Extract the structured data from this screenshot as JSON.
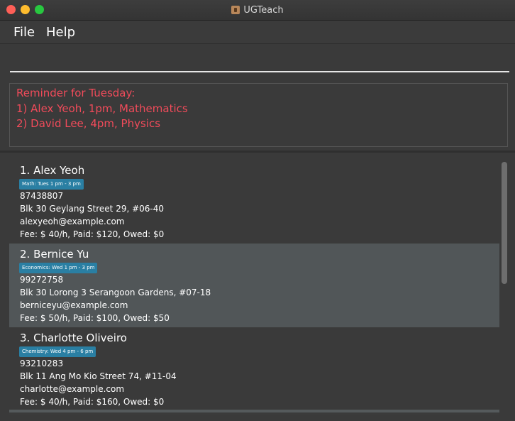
{
  "window": {
    "title": "UGTeach"
  },
  "menu": {
    "file": "File",
    "help": "Help"
  },
  "command": {
    "value": "",
    "placeholder": ""
  },
  "result": {
    "lines": [
      "Reminder for Tuesday:",
      "1) Alex Yeoh, 1pm, Mathematics",
      "2) David Lee, 4pm, Physics"
    ],
    "color": "#f04b5a"
  },
  "students": [
    {
      "name": "1. Alex Yeoh",
      "tag": "Math: Tues 1 pm - 3 pm",
      "phone": "87438807",
      "address": "Blk 30 Geylang Street 29, #06-40",
      "email": "alexyeoh@example.com",
      "fee": "Fee: $ 40/h, Paid: $120, Owed: $0"
    },
    {
      "name": "2. Bernice Yu",
      "tag": "Economics: Wed 1 pm - 3 pm",
      "phone": "99272758",
      "address": "Blk 30 Lorong 3 Serangoon Gardens, #07-18",
      "email": "berniceyu@example.com",
      "fee": "Fee: $ 50/h, Paid: $100, Owed: $50"
    },
    {
      "name": "3. Charlotte Oliveiro",
      "tag": "Chemistry: Wed 4 pm - 6 pm",
      "phone": "93210283",
      "address": "Blk 11 Ang Mo Kio Street 74, #11-04",
      "email": "charlotte@example.com",
      "fee": "Fee: $ 40/h, Paid: $160, Owed: $0"
    }
  ],
  "colors": {
    "tag_background": "#2a7fa3",
    "selected_row": "#515658",
    "background": "#3a3a3a"
  }
}
